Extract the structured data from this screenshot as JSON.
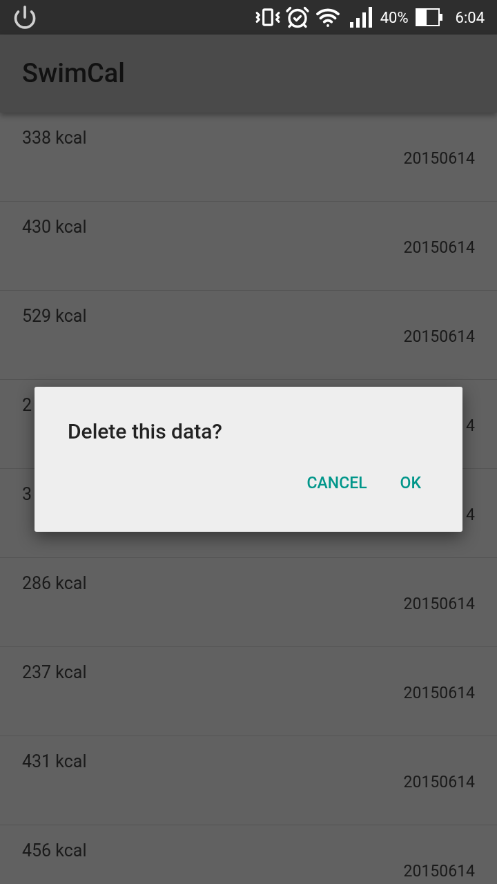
{
  "status_bar": {
    "battery_percent": "40%",
    "time": "6:04"
  },
  "app_bar": {
    "title": "SwimCal"
  },
  "list": [
    {
      "calories": "338 kcal",
      "date": "20150614"
    },
    {
      "calories": "430 kcal",
      "date": "20150614"
    },
    {
      "calories": "529 kcal",
      "date": "20150614"
    },
    {
      "calories": "2",
      "date": "4"
    },
    {
      "calories": "3",
      "date": "4"
    },
    {
      "calories": "286 kcal",
      "date": "20150614"
    },
    {
      "calories": "237 kcal",
      "date": "20150614"
    },
    {
      "calories": "431 kcal",
      "date": "20150614"
    },
    {
      "calories": "456 kcal",
      "date": "20150614"
    }
  ],
  "dialog": {
    "title": "Delete this data?",
    "buttons": [
      "CANCEL",
      "OK"
    ]
  }
}
